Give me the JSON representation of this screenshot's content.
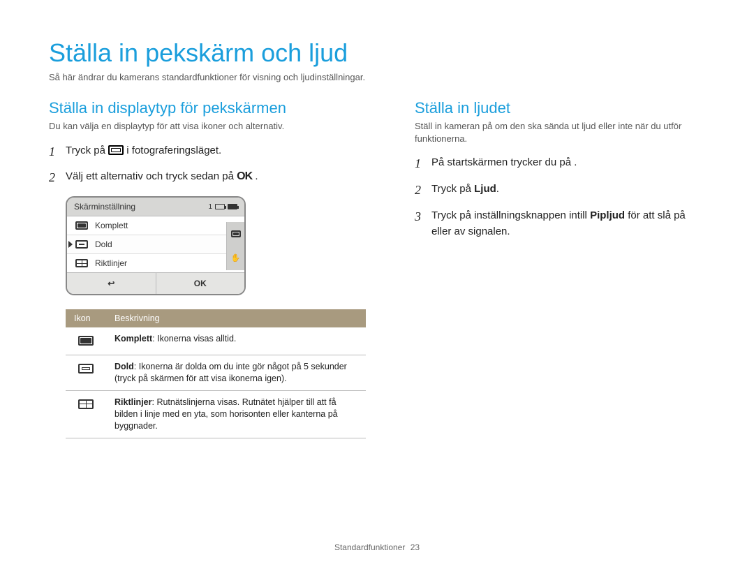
{
  "page_title": "Ställa in pekskärm och ljud",
  "intro": "Så här ändrar du kamerans standardfunktioner för visning och ljudinställningar.",
  "left": {
    "heading": "Ställa in displaytyp för pekskärmen",
    "subtext": "Du kan välja en displaytyp för att visa ikoner och alternativ.",
    "steps": [
      {
        "num": "1",
        "before": "Tryck på ",
        "after": " i fotograferingsläget."
      },
      {
        "num": "2",
        "before": "Välj ett alternativ och tryck sedan på ",
        "after": " ."
      }
    ],
    "menu": {
      "title": "Skärminställning",
      "counter": "1",
      "items": [
        {
          "label": "Komplett",
          "icon": "full",
          "selected": false
        },
        {
          "label": "Dold",
          "icon": "half",
          "selected": true
        },
        {
          "label": "Riktlinjer",
          "icon": "grid",
          "selected": false
        }
      ],
      "back": "↩",
      "ok": "OK"
    },
    "table": {
      "head_icon": "Ikon",
      "head_desc": "Beskrivning",
      "rows": [
        {
          "icon": "full",
          "bold": "Komplett",
          "text": ": Ikonerna visas alltid."
        },
        {
          "icon": "half",
          "bold": "Dold",
          "text": ": Ikonerna är dolda om du inte gör något på 5 sekunder (tryck på skärmen för att visa ikonerna igen)."
        },
        {
          "icon": "grid",
          "bold": "Riktlinjer",
          "text": ": Rutnätslinjerna visas. Rutnätet hjälper till att få bilden i linje med en yta, som horisonten eller kanterna på byggnader."
        }
      ]
    }
  },
  "right": {
    "heading": "Ställa in ljudet",
    "subtext": "Ställ in kameran på om den ska sända ut ljud eller inte när du utför funktionerna.",
    "steps": [
      {
        "num": "1",
        "html": "På startskärmen trycker du på     ."
      },
      {
        "num": "2",
        "before": "Tryck på ",
        "bold": "Ljud",
        "after": "."
      },
      {
        "num": "3",
        "before": "Tryck på inställningsknappen intill ",
        "bold": "Pipljud",
        "after": " för att slå på eller av signalen."
      }
    ]
  },
  "footer": {
    "section": "Standardfunktioner",
    "page": "23"
  }
}
